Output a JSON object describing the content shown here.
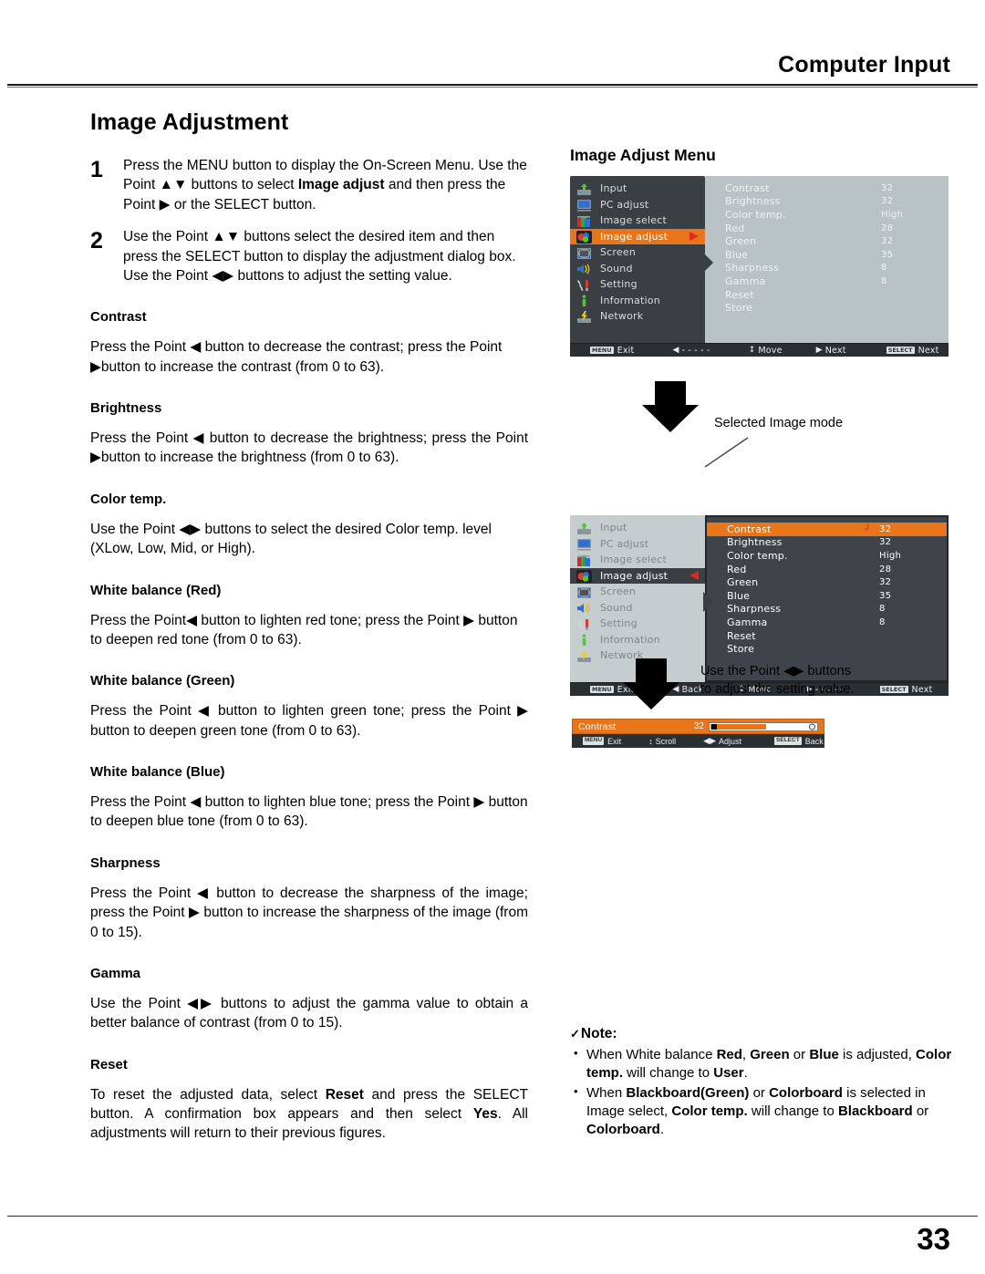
{
  "page": {
    "header": "Computer Input",
    "number": "33",
    "title": "Image Adjustment"
  },
  "steps": [
    {
      "num": "1",
      "parts": [
        {
          "t": "Press the MENU button to display the On-Screen Menu. Use the Point ▲▼ buttons to select ",
          "b": false
        },
        {
          "t": "Image adjust",
          "b": true
        },
        {
          "t": " and then press the Point ▶ or the SELECT button.",
          "b": false
        }
      ]
    },
    {
      "num": "2",
      "parts": [
        {
          "t": "Use the Point ▲▼ buttons select the desired item and then press the SELECT button to display the adjustment dialog box. Use the Point ◀▶ buttons to adjust the setting value.",
          "b": false
        }
      ]
    }
  ],
  "sections": [
    {
      "heading": "Contrast",
      "justify": false,
      "parts": [
        {
          "t": "Press the Point ◀ button to decrease the contrast; press the Point ▶button to increase the contrast (from 0 to 63).",
          "b": false
        }
      ]
    },
    {
      "heading": "Brightness",
      "justify": true,
      "parts": [
        {
          "t": "Press the Point ◀ button to decrease the brightness; press the Point ▶button to increase the brightness (from 0 to 63).",
          "b": false
        }
      ]
    },
    {
      "heading": "Color temp.",
      "justify": false,
      "parts": [
        {
          "t": "Use the Point ◀▶ buttons to select the desired Color temp. level (XLow, Low, Mid, or High).",
          "b": false
        }
      ]
    },
    {
      "heading": "White balance (Red)",
      "justify": false,
      "parts": [
        {
          "t": "Press the Point◀ button to lighten red tone; press the Point ▶ button to deepen red tone (from 0 to 63).",
          "b": false
        }
      ]
    },
    {
      "heading": "White balance (Green)",
      "justify": true,
      "parts": [
        {
          "t": "Press the Point ◀ button to lighten green tone; press the Point ▶ button to deepen green tone (from 0 to 63).",
          "b": false
        }
      ]
    },
    {
      "heading": "White balance (Blue)",
      "justify": false,
      "parts": [
        {
          "t": "Press the Point ◀ button to lighten blue tone; press the Point ▶ button to deepen blue tone (from 0 to 63).",
          "b": false
        }
      ]
    },
    {
      "heading": "Sharpness",
      "justify": true,
      "parts": [
        {
          "t": "Press the Point ◀ button to decrease the sharpness of the image; press the Point ▶ button to increase the sharpness of the image (from 0 to 15).",
          "b": false
        }
      ]
    },
    {
      "heading": "Gamma",
      "justify": true,
      "parts": [
        {
          "t": "Use the Point ◀▶ buttons to adjust the gamma value to obtain a better balance of contrast (from 0 to 15).",
          "b": false
        }
      ]
    },
    {
      "heading": "Reset",
      "justify": true,
      "parts": [
        {
          "t": "To reset the adjusted data, select ",
          "b": false
        },
        {
          "t": "Reset",
          "b": true
        },
        {
          "t": " and press the SELECT button. A confirmation box appears and then select ",
          "b": false
        },
        {
          "t": "Yes",
          "b": true
        },
        {
          "t": ". All adjustments will return to their previous figures.",
          "b": false
        }
      ]
    }
  ],
  "osd": {
    "title": "Image Adjust Menu",
    "sidebar": [
      {
        "label": "Input",
        "icon": "input-icon"
      },
      {
        "label": "PC adjust",
        "icon": "monitor-icon"
      },
      {
        "label": "Image select",
        "icon": "image-select-icon"
      },
      {
        "label": "Image adjust",
        "icon": "image-adjust-icon"
      },
      {
        "label": "Screen",
        "icon": "screen-icon"
      },
      {
        "label": "Sound",
        "icon": "speaker-icon"
      },
      {
        "label": "Setting",
        "icon": "tools-icon"
      },
      {
        "label": "Information",
        "icon": "info-icon"
      },
      {
        "label": "Network",
        "icon": "network-icon"
      }
    ],
    "selected_index": 3,
    "panel1_arrow": "▶",
    "panel2_arrow": "◀",
    "items": [
      {
        "label": "Contrast",
        "value": "32"
      },
      {
        "label": "Brightness",
        "value": "32"
      },
      {
        "label": "Color temp.",
        "value": "High"
      },
      {
        "label": "Red",
        "value": "28"
      },
      {
        "label": "Green",
        "value": "32"
      },
      {
        "label": "Blue",
        "value": "35"
      },
      {
        "label": "Sharpness",
        "value": "8"
      },
      {
        "label": "Gamma",
        "value": "8"
      },
      {
        "label": "Reset",
        "value": ""
      },
      {
        "label": "Store",
        "value": ""
      }
    ],
    "panel2_selected_item": 0,
    "panel2_selected_mark": "┘",
    "bar1": [
      {
        "cap": "MENU",
        "glyph": "",
        "text": "Exit"
      },
      {
        "cap": "",
        "glyph": "◀",
        "text": "- - - - -"
      },
      {
        "cap": "",
        "glyph": "↕",
        "text": "Move"
      },
      {
        "cap": "",
        "glyph": "▶",
        "text": "Next"
      },
      {
        "cap": "SELECT",
        "glyph": "",
        "text": "Next"
      }
    ],
    "bar2": [
      {
        "cap": "MENU",
        "glyph": "",
        "text": "Exit"
      },
      {
        "cap": "",
        "glyph": "◀",
        "text": "Back"
      },
      {
        "cap": "",
        "glyph": "↕",
        "text": "Move"
      },
      {
        "cap": "",
        "glyph": "▶",
        "text": "- - - - -"
      },
      {
        "cap": "SELECT",
        "glyph": "",
        "text": "Next"
      }
    ],
    "callout_selected_mode": "Selected Image mode",
    "callout_adjust": "Use the Point ◀▶ buttons to adjust the setting value.",
    "dialog": {
      "name": "Contrast",
      "value": "32",
      "bar": [
        {
          "cap": "MENU",
          "glyph": "",
          "text": "Exit"
        },
        {
          "cap": "",
          "glyph": "↕",
          "text": "Scroll"
        },
        {
          "cap": "",
          "glyph": "◀▶",
          "text": "Adjust"
        },
        {
          "cap": "SELECT",
          "glyph": "",
          "text": "Back"
        }
      ]
    },
    "accent": "#e8751a",
    "red": "#e2281e"
  },
  "note": {
    "check": "✓",
    "heading": "Note:",
    "items": [
      [
        {
          "t": "When White balance ",
          "b": false
        },
        {
          "t": "Red",
          "b": true
        },
        {
          "t": ", ",
          "b": false
        },
        {
          "t": "Green",
          "b": true
        },
        {
          "t": " or ",
          "b": false
        },
        {
          "t": "Blue",
          "b": true
        },
        {
          "t": " is adjusted, ",
          "b": false
        },
        {
          "t": "Color temp.",
          "b": true
        },
        {
          "t": " will change to ",
          "b": false
        },
        {
          "t": "User",
          "b": true
        },
        {
          "t": ".",
          "b": false
        }
      ],
      [
        {
          "t": "When ",
          "b": false
        },
        {
          "t": "Blackboard(Green)",
          "b": true
        },
        {
          "t": " or ",
          "b": false
        },
        {
          "t": "Colorboard",
          "b": true
        },
        {
          "t": " is selected in Image select, ",
          "b": false
        },
        {
          "t": "Color temp.",
          "b": true
        },
        {
          "t": " will change to ",
          "b": false
        },
        {
          "t": "Blackboard",
          "b": true
        },
        {
          "t": " or ",
          "b": false
        },
        {
          "t": "Colorboard",
          "b": true
        },
        {
          "t": ".",
          "b": false
        }
      ]
    ]
  }
}
